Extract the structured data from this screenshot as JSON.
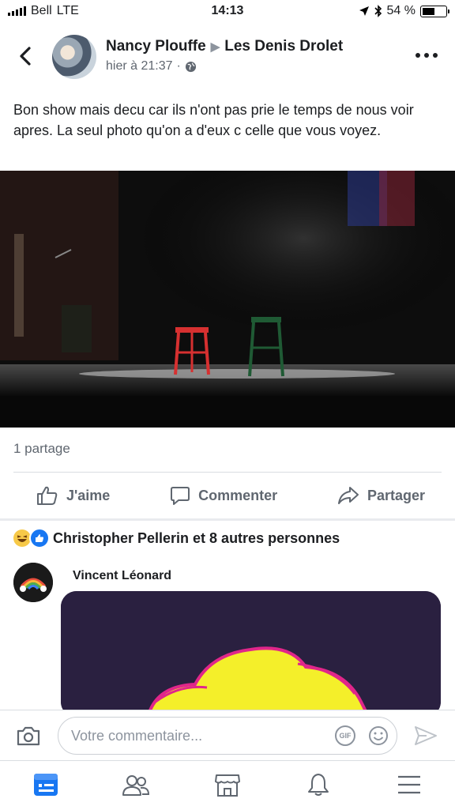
{
  "status": {
    "carrier": "Bell",
    "network": "LTE",
    "time": "14:13",
    "battery": "54 %",
    "battery_level": 0.54
  },
  "header": {
    "author": "Nancy Plouffe",
    "target": "Les Denis Drolet",
    "timestamp": "hier à 21:37",
    "separator": "·",
    "privacy_icon": "globe-icon"
  },
  "post": {
    "text": "Bon show mais decu car ils n'ont pas prie le temps de nous voir apres. La seul photo qu'on a d'eux c celle que vous voyez."
  },
  "stats": {
    "shares": "1 partage"
  },
  "actions": {
    "like": "J'aime",
    "comment": "Commenter",
    "share": "Partager"
  },
  "reactions": {
    "text": "Christopher Pellerin et 8 autres personnes"
  },
  "comment": {
    "author": "Vincent Léonard"
  },
  "composer": {
    "placeholder": "Votre commentaire...",
    "gif": "GIF"
  },
  "colors": {
    "accent": "#1877f2",
    "muted": "#606770"
  }
}
